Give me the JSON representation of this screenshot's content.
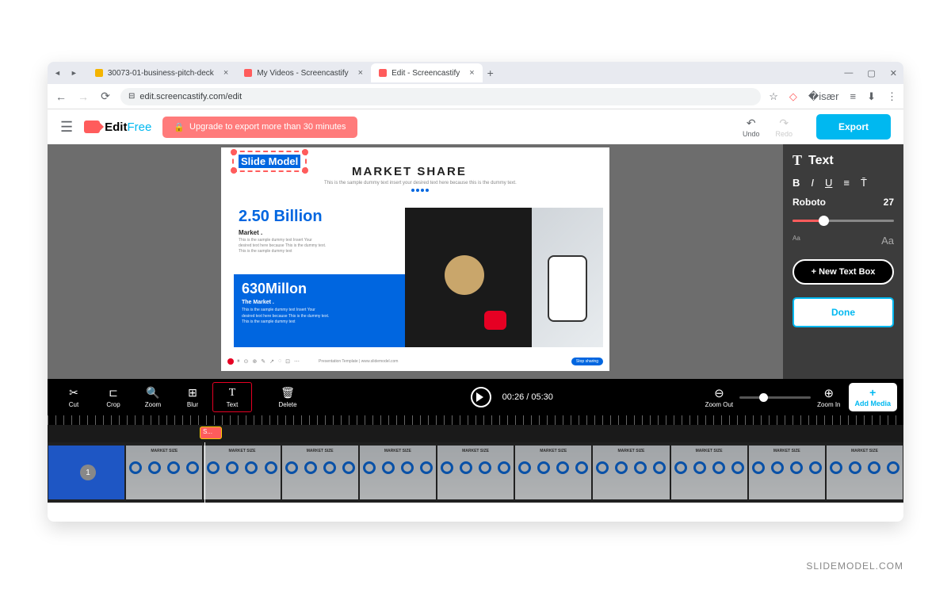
{
  "browser": {
    "tabs": [
      {
        "title": "30073-01-business-pitch-deck"
      },
      {
        "title": "My Videos - Screencastify"
      },
      {
        "title": "Edit - Screencastify"
      }
    ],
    "url": "edit.screencastify.com/edit",
    "newtab": "+"
  },
  "app": {
    "logo": {
      "main": "Edit",
      "sub": "Free"
    },
    "upgrade": "Upgrade to export more than 30 minutes",
    "undo": "Undo",
    "redo": "Redo",
    "export": "Export"
  },
  "slide": {
    "textbox": "Slide Model",
    "title": "MARKET SHARE",
    "subtitle": "This is the sample dummy text insert your desired text here because this is the dummy text.",
    "stat1": {
      "num": "2.50 Billion",
      "label": "Market .",
      "desc": "This is the sample dummy text Insert Your\ndesired text here because This is the dummy text.\nThis is the sample dummy text"
    },
    "stat2": {
      "num": "630Millon",
      "label": "The Market .",
      "desc": "This is the sample dummy text Insert Your\ndesired text here because This is the dummy text.\nThis is the sample dummy text"
    },
    "footer": "Presentation Template | www.slidemodel.com",
    "stopshare": "Stop sharing"
  },
  "textpanel": {
    "title": "Text",
    "font": "Roboto",
    "size": "27",
    "newtext": "+ New Text Box",
    "done": "Done"
  },
  "toolbar": {
    "cut": "Cut",
    "crop": "Crop",
    "zoom": "Zoom",
    "blur": "Blur",
    "text": "Text",
    "delete": "Delete",
    "time": "00:26 / 05:30",
    "zoomout": "Zoom Out",
    "zoomin": "Zoom In",
    "addmedia": "Add Media"
  },
  "textchip": "S...",
  "thumbLabel": "MARKET SIZE",
  "watermark": "SLIDEMODEL.COM"
}
